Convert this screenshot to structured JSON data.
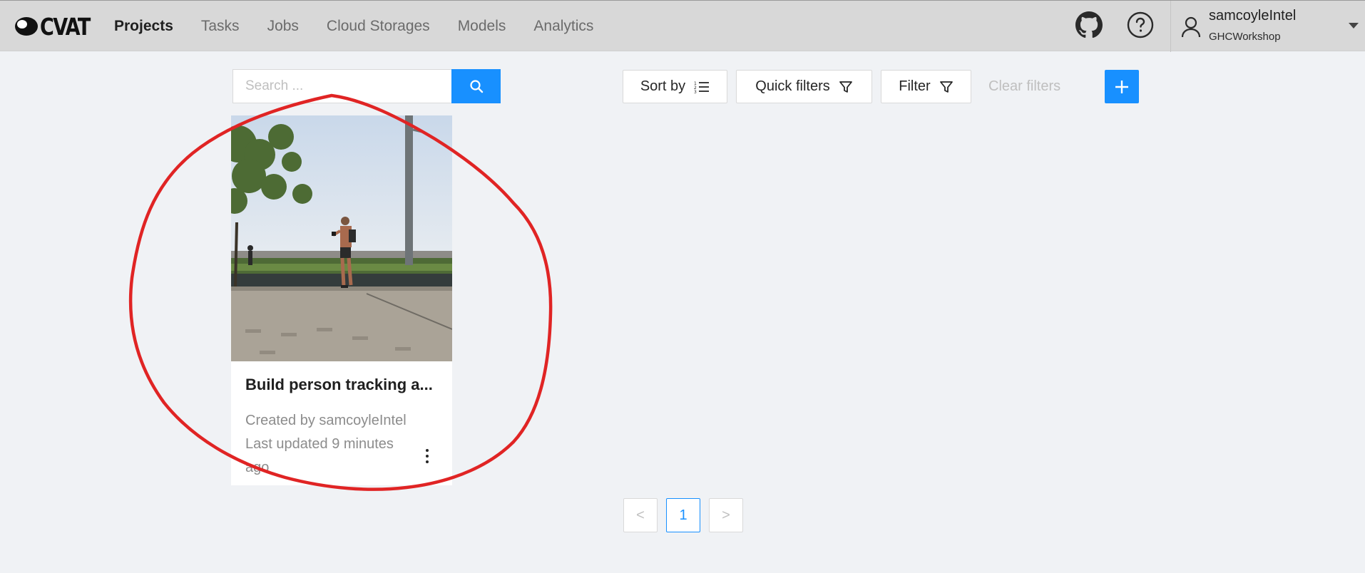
{
  "header": {
    "logo_text": "CVAT",
    "nav": [
      "Projects",
      "Tasks",
      "Jobs",
      "Cloud Storages",
      "Models",
      "Analytics"
    ],
    "active_nav": "Projects",
    "user": {
      "name": "samcoyleIntel",
      "org": "GHCWorkshop"
    }
  },
  "toolbar": {
    "search_placeholder": "Search ...",
    "sort_label": "Sort by",
    "quick_filters_label": "Quick filters",
    "filter_label": "Filter",
    "clear_filters_label": "Clear filters"
  },
  "projects": [
    {
      "title": "Build person tracking a...",
      "created_by": "Created by samcoyleIntel",
      "updated": "Last updated 9 minutes ago"
    }
  ],
  "pagination": {
    "current_page": "1",
    "prev_symbol": "<",
    "next_symbol": ">"
  },
  "colors": {
    "accent": "#1890ff",
    "header_bg": "#d8d8d8",
    "page_bg": "#f0f2f5",
    "annotation": "#e02424"
  }
}
